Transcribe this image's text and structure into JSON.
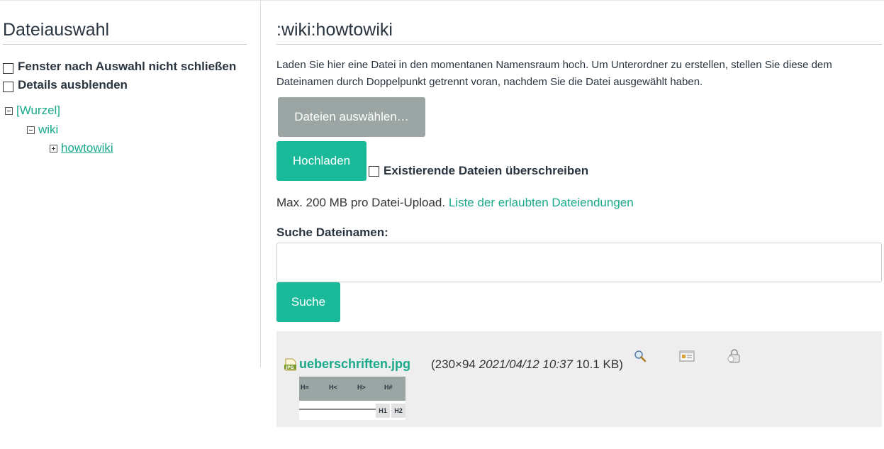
{
  "left": {
    "title": "Dateiauswahl",
    "options": [
      "Fenster nach Auswahl nicht schließen",
      "Details ausblenden"
    ],
    "tree": {
      "root": "[Wurzel]",
      "child": "wiki",
      "grandchild": "howtowiki"
    }
  },
  "right": {
    "title": ":wiki:howtowiki",
    "intro": "Laden Sie hier eine Datei in den momentanen Namensraum hoch. Um Unterordner zu erstellen, stellen Sie diese dem Dateinamen durch Doppelpunkt getrennt voran, nachdem Sie die Datei ausgewählt haben.",
    "choose_files": "Dateien auswählen…",
    "upload": "Hochladen",
    "overwrite_label": "Existierende Dateien überschreiben",
    "max_text": "Max. 200 MB pro Datei-Upload.",
    "allowed_link": "Liste der erlaubten Dateiendungen",
    "search_label": "Suche Dateinamen:",
    "search_value": "",
    "search_button": "Suche"
  },
  "file": {
    "name": "ueberschriften.jpg",
    "dimensions_prefix": "(230×94",
    "date": "2021/04/12 10:37",
    "size_suffix": "10.1 KB)",
    "thumb_labels": [
      "H=",
      "H<",
      "H>",
      "H#"
    ],
    "thumb_boxes": [
      "H1",
      "H2"
    ],
    "icons": [
      "magnifier-icon",
      "details-icon",
      "delete-lock-icon"
    ]
  },
  "colors": {
    "accent": "#1ab99a",
    "link": "#1aa98a",
    "grey_button": "#9aa5a4",
    "result_bg": "#eeeeee"
  }
}
